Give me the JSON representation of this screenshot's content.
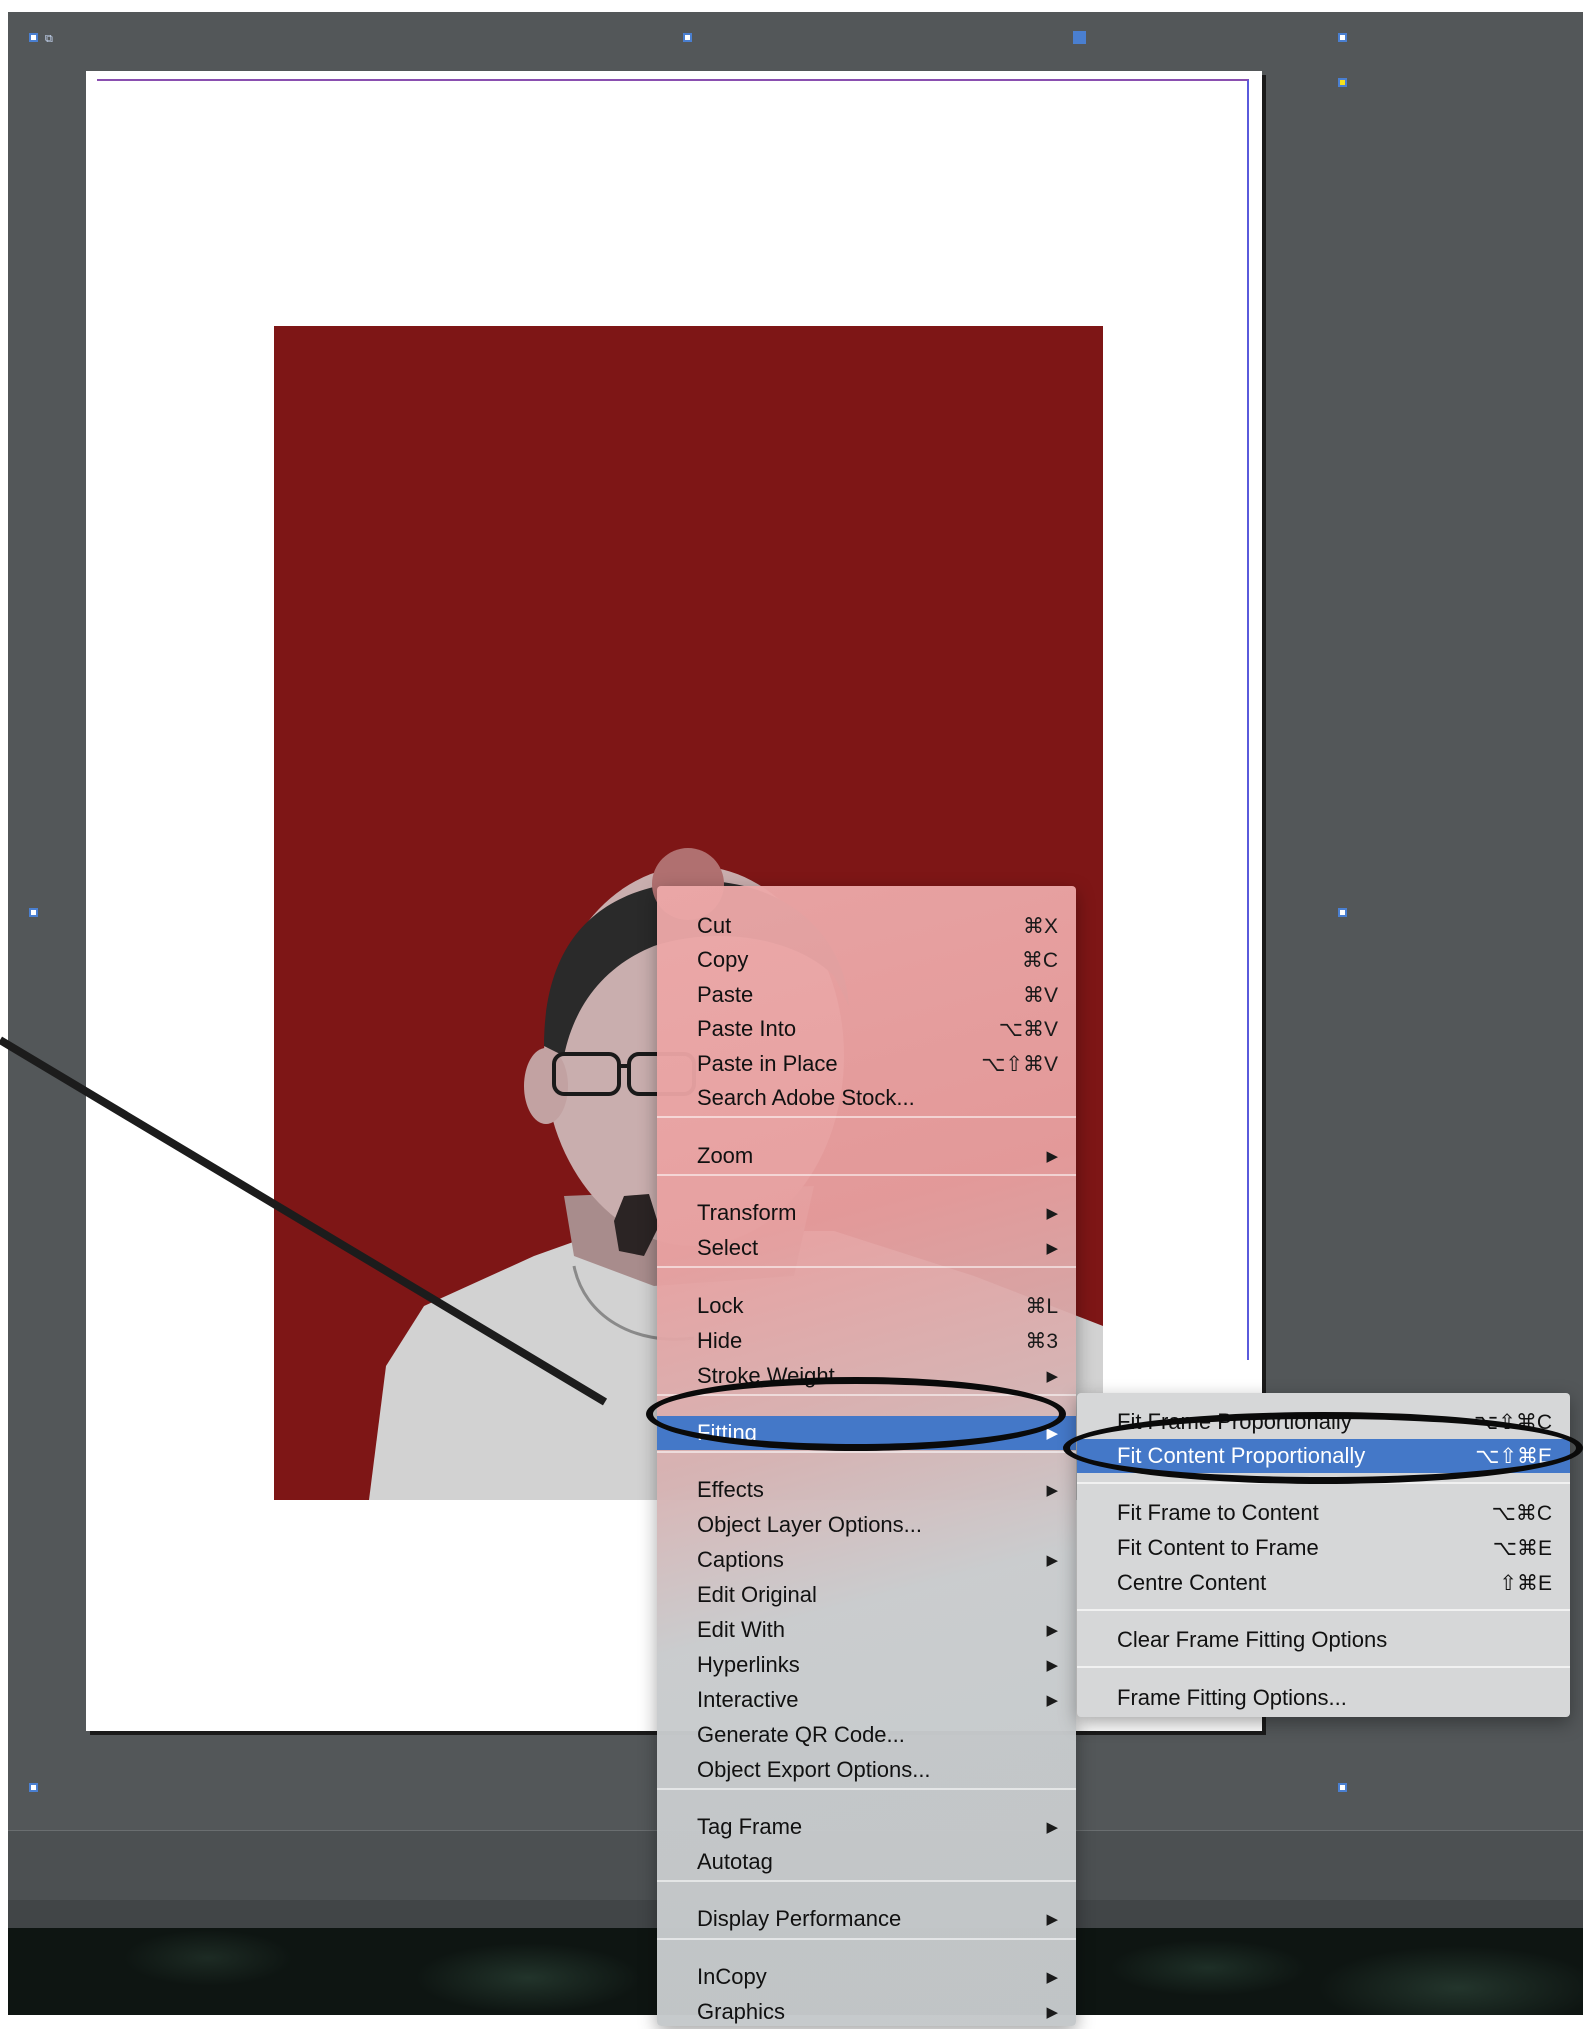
{
  "window": {
    "link_icon": "linked-frame-icon"
  },
  "context_menu": {
    "items": [
      {
        "label": "Cut",
        "shortcut": "⌘X"
      },
      {
        "label": "Copy",
        "shortcut": "⌘C"
      },
      {
        "label": "Paste",
        "shortcut": "⌘V"
      },
      {
        "label": "Paste Into",
        "shortcut": "⌥⌘V"
      },
      {
        "label": "Paste in Place",
        "shortcut": "⌥⇧⌘V"
      },
      {
        "label": "Search Adobe Stock...",
        "shortcut": ""
      },
      {
        "label": "Zoom",
        "submenu": true
      },
      {
        "label": "Transform",
        "submenu": true
      },
      {
        "label": "Select",
        "submenu": true
      },
      {
        "label": "Lock",
        "shortcut": "⌘L"
      },
      {
        "label": "Hide",
        "shortcut": "⌘3"
      },
      {
        "label": "Stroke Weight",
        "submenu": true
      },
      {
        "label": "Fitting",
        "submenu": true,
        "highlighted": true
      },
      {
        "label": "Effects",
        "submenu": true
      },
      {
        "label": "Object Layer Options...",
        "shortcut": ""
      },
      {
        "label": "Captions",
        "submenu": true
      },
      {
        "label": "Edit Original",
        "shortcut": ""
      },
      {
        "label": "Edit With",
        "submenu": true
      },
      {
        "label": "Hyperlinks",
        "submenu": true
      },
      {
        "label": "Interactive",
        "submenu": true
      },
      {
        "label": "Generate QR Code...",
        "shortcut": ""
      },
      {
        "label": "Object Export Options...",
        "shortcut": ""
      },
      {
        "label": "Tag Frame",
        "submenu": true
      },
      {
        "label": "Autotag",
        "shortcut": ""
      },
      {
        "label": "Display Performance",
        "submenu": true
      },
      {
        "label": "InCopy",
        "submenu": true
      },
      {
        "label": "Graphics",
        "submenu": true
      }
    ]
  },
  "fitting_submenu": {
    "items": [
      {
        "label": "Fit Frame Proportionally",
        "shortcut": "⌥⇧⌘C"
      },
      {
        "label": "Fit Content Proportionally",
        "shortcut": "⌥⇧⌘E",
        "highlighted": true
      },
      {
        "label": "Fit Frame to Content",
        "shortcut": "⌥⌘C"
      },
      {
        "label": "Fit Content to Frame",
        "shortcut": "⌥⌘E"
      },
      {
        "label": "Centre Content",
        "shortcut": "⇧⌘E"
      },
      {
        "label": "Clear Frame Fitting Options",
        "shortcut": ""
      },
      {
        "label": "Frame Fitting Options...",
        "shortcut": ""
      }
    ]
  },
  "colors": {
    "pasteboard": "#535759",
    "photo_background": "#7e1616",
    "highlight": "#4478c8",
    "margin_guide": "#8a4fb0"
  }
}
